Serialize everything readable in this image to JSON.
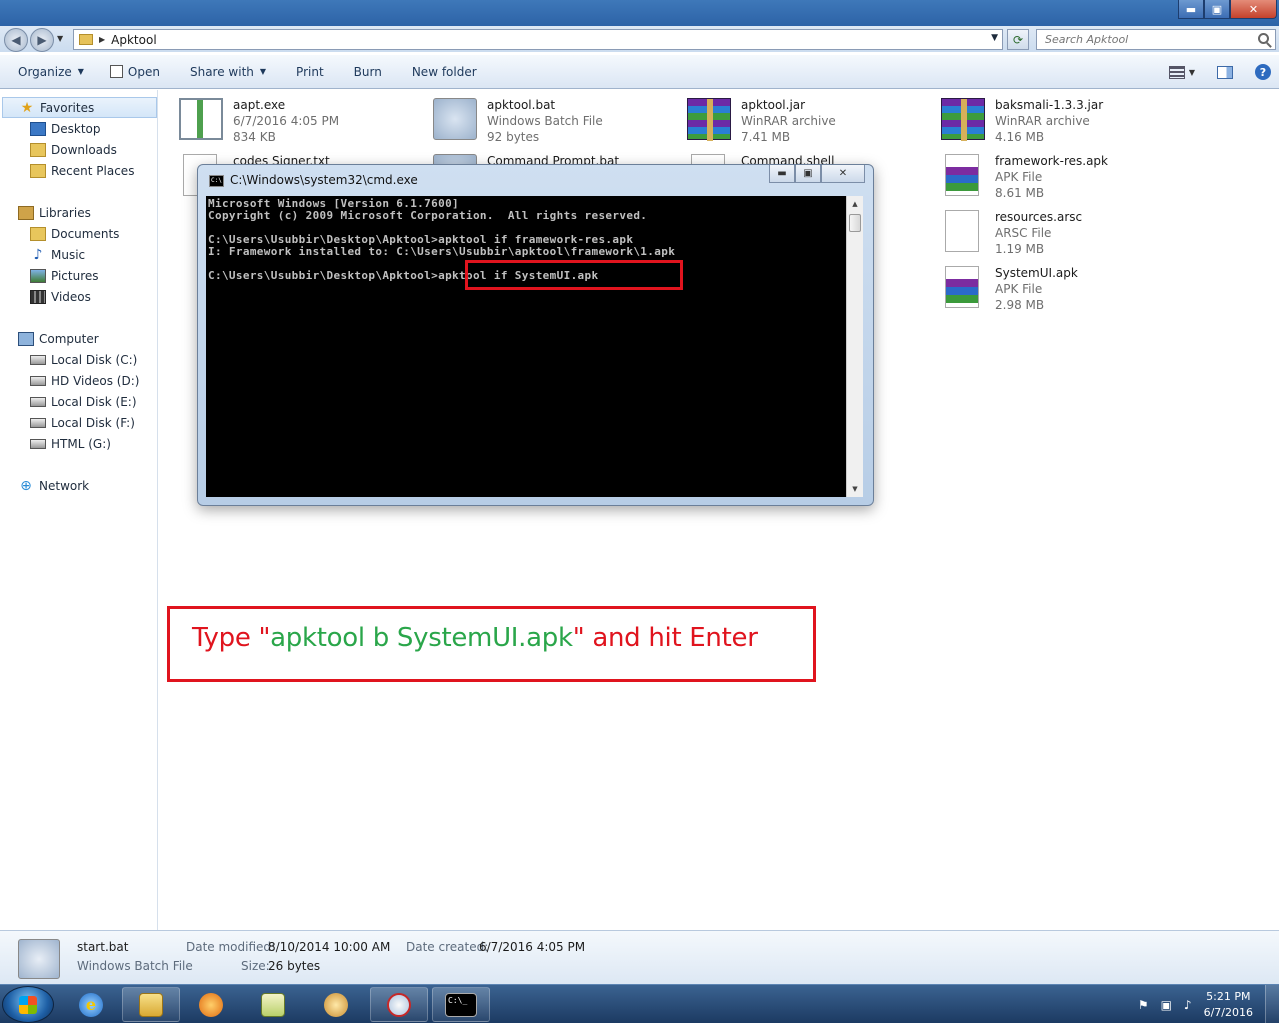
{
  "window": {
    "minimize_label": "▬",
    "maximize_label": "▣",
    "close_label": "✕"
  },
  "address": {
    "path": "Apktool",
    "search_placeholder": "Search Apktool"
  },
  "toolbar": {
    "organize": "Organize",
    "open": "Open",
    "share_with": "Share with",
    "print": "Print",
    "burn": "Burn",
    "new_folder": "New folder"
  },
  "sidebar": {
    "favorites": "Favorites",
    "desktop": "Desktop",
    "downloads": "Downloads",
    "recent_places": "Recent Places",
    "libraries": "Libraries",
    "documents": "Documents",
    "music": "Music",
    "pictures": "Pictures",
    "videos": "Videos",
    "computer": "Computer",
    "drive_c": "Local Disk (C:)",
    "drive_d": "HD Videos (D:)",
    "drive_e": "Local Disk (E:)",
    "drive_f": "Local Disk (F:)",
    "drive_g": "HTML (G:)",
    "network": "Network"
  },
  "files": {
    "aapt": {
      "name": "aapt.exe",
      "line2": "6/7/2016 4:05 PM",
      "line3": "834 KB"
    },
    "apktool_bat": {
      "name": "apktool.bat",
      "line2": "Windows Batch File",
      "line3": "92 bytes"
    },
    "apktool_jar": {
      "name": "apktool.jar",
      "line2": "WinRAR archive",
      "line3": "7.41 MB"
    },
    "baksmali": {
      "name": "baksmali-1.3.3.jar",
      "line2": "WinRAR archive",
      "line3": "4.16 MB"
    },
    "codes_signer": {
      "name": "codes Signer.txt"
    },
    "command_prompt": {
      "name": "Command Prompt.bat"
    },
    "command_shell": {
      "name": "Command.shell"
    },
    "framework_res": {
      "name": "framework-res.apk",
      "line2": "APK File",
      "line3": "8.61 MB"
    },
    "resources": {
      "name": "resources.arsc",
      "line2": "ARSC File",
      "line3": "1.19 MB"
    },
    "systemui": {
      "name": "SystemUI.apk",
      "line2": "APK File",
      "line3": "2.98 MB"
    }
  },
  "cmd": {
    "title": "C:\\Windows\\system32\\cmd.exe",
    "icon_text": "C:\\",
    "lines": [
      "Microsoft Windows [Version 6.1.7600]",
      "Copyright (c) 2009 Microsoft Corporation.  All rights reserved.",
      "",
      "C:\\Users\\Usubbir\\Desktop\\Apktool>apktool if framework-res.apk",
      "I: Framework installed to: C:\\Users\\Usubbir\\apktool\\framework\\1.apk",
      "",
      "C:\\Users\\Usubbir\\Desktop\\Apktool>apktool if SystemUI.apk"
    ]
  },
  "annotation": {
    "prefix": "Type \"",
    "command": "apktool b SystemUI.apk",
    "suffix": "\" and hit Enter"
  },
  "details": {
    "name": "start.bat",
    "type": "Windows Batch File",
    "modified_label": "Date modified:",
    "modified_value": "8/10/2014 10:00 AM",
    "size_label": "Size:",
    "size_value": "26 bytes",
    "created_label": "Date created:",
    "created_value": "6/7/2016 4:05 PM"
  },
  "taskbar": {
    "ie_glyph": "e",
    "cmd_glyph": "C:\\_",
    "time": "5:21 PM",
    "date": "6/7/2016"
  },
  "colors": {
    "annotation_red": "#e0141e",
    "annotation_green": "#2aa64a"
  }
}
